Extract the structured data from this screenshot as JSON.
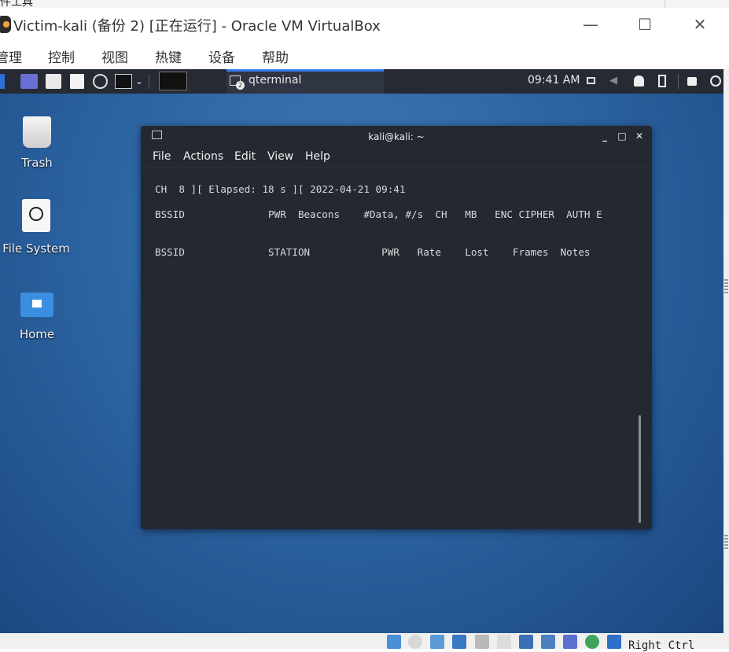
{
  "behind": {
    "text": "件工具"
  },
  "window": {
    "title": "Victim-kali (备份 2) [正在运行] - Oracle VM VirtualBox",
    "controls": {
      "minimize": "—",
      "maximize": "☐",
      "close": "✕"
    }
  },
  "vbox_menu": [
    "管理",
    "控制",
    "视图",
    "热键",
    "设备",
    "帮助"
  ],
  "panel": {
    "task_label": "qterminal",
    "task_badge": "2",
    "clock": "09:41 AM"
  },
  "desktop": {
    "icons": [
      {
        "label": "Trash"
      },
      {
        "label": "File System"
      },
      {
        "label": "Home"
      }
    ]
  },
  "terminal": {
    "title": "kali@kali: ~",
    "menu": [
      "File",
      "Actions",
      "Edit",
      "View",
      "Help"
    ],
    "lines": [
      "CH  8 ][ Elapsed: 18 s ][ 2022-04-21 09:41",
      "BSSID              PWR  Beacons    #Data, #/s  CH   MB   ENC CIPHER  AUTH E",
      "BSSID              STATION            PWR   Rate    Lost    Frames  Notes"
    ]
  },
  "statusbar": {
    "host_key": "Right Ctrl"
  },
  "colors": {
    "panel": "#252a33",
    "terminal_bg": "#232831",
    "accent": "#367bf0"
  }
}
